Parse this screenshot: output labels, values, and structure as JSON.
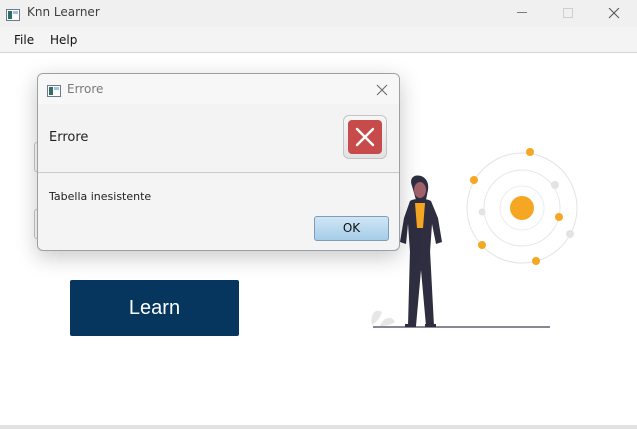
{
  "window": {
    "title": "Knn Learner",
    "icons": [
      "app-icon",
      "minimize-icon",
      "maximize-icon",
      "close-icon"
    ]
  },
  "menu": {
    "items": [
      {
        "label": "File"
      },
      {
        "label": "Help"
      }
    ]
  },
  "main": {
    "learn_label": "Learn",
    "accent_color": "#06355d"
  },
  "illustration": {
    "subject": "woman-with-orbit-illustration",
    "accent_color": "#f5a623",
    "figure_color": "#2f2e41"
  },
  "dialog": {
    "title": "Errore",
    "header": "Errore",
    "message": "Tabella inesistente",
    "ok_label": "OK",
    "icon": "error-x-icon",
    "error_color": "#c74b4b"
  }
}
